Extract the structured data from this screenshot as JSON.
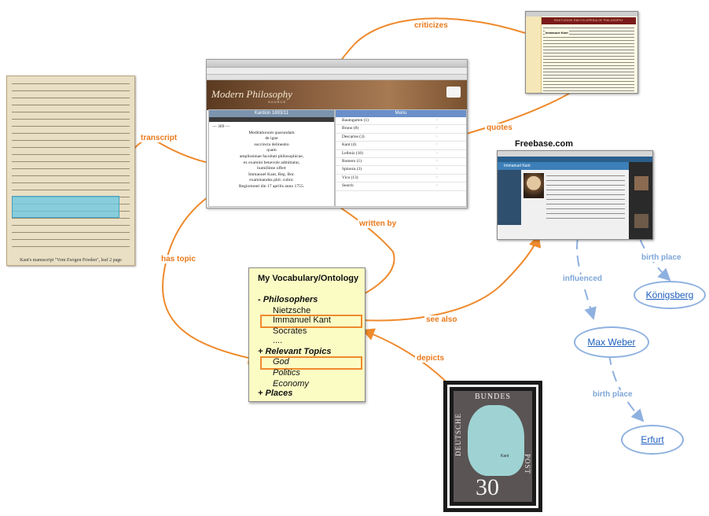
{
  "manuscript": {
    "caption": "Kant's manuscript \"Vom Ewigen Frieden\", leaf 2 page"
  },
  "website": {
    "left_header": "Kantion 1693/11",
    "right_header": "Menu",
    "text_lines": [
      "— 369 —",
      "Meditationum quarundam",
      "de igne",
      "succincta delineatio",
      "quam",
      "amplissimae facultati philosophicae,",
      "ex examini benevole admittatur,",
      "humillime offert",
      "Immanuel Kant, Reg. Bor.",
      "examinandus phil. cultor.",
      "Regiomonti die 17 aprilis anno 1755."
    ],
    "menu_items": [
      "Baumgarten (1)",
      "Bruno (8)",
      "Descartes (3)",
      "Kant (4)",
      "Leibniz (18)",
      "Romero (1)",
      "Spinoza (3)",
      "Vico (13)",
      "Search"
    ]
  },
  "freebase": {
    "label": "Freebase.com",
    "entity": "Immanuel Kant"
  },
  "vocabulary": {
    "title": "My Vocabulary/Ontology",
    "philosophers_heading": "- Philosophers",
    "philosophers": [
      "Nietzsche",
      "Immanuel Kant",
      "Socrates",
      "...."
    ],
    "topics_heading": "+ Relevant Topics",
    "topics": [
      "God",
      "Politics",
      "Economy"
    ],
    "places_heading": "+ Places"
  },
  "stamp": {
    "top": "BUNDES",
    "left": "DEUTSCHE",
    "right": "POST",
    "value": "30",
    "name": "Kant"
  },
  "entities": {
    "konigsberg": "Königsberg",
    "max_weber": "Max Weber",
    "erfurt": "Erfurt"
  },
  "edges": {
    "criticizes": "criticizes",
    "quotes": "quotes",
    "transcript": "transcript",
    "written_by": "written by",
    "has_topic": "has topic",
    "see_also": "see also",
    "depicts": "depicts",
    "influenced": "influenced",
    "birth_place_1": "birth place",
    "birth_place_2": "birth place"
  },
  "colors": {
    "link_orange": "#ef8a2c",
    "link_blue": "#8fb1e0",
    "vocab_bg": "#fbfcc4"
  }
}
